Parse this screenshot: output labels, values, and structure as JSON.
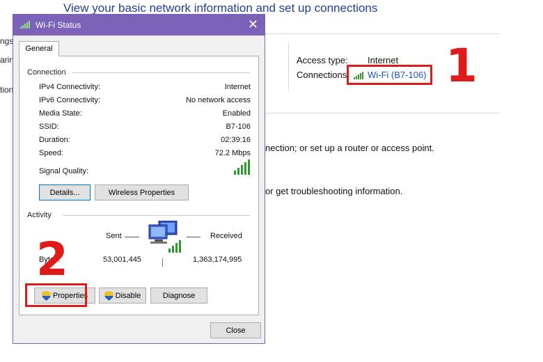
{
  "background": {
    "title": "View your basic network information and set up connections",
    "left_fragments": [
      "ngs",
      "arin",
      "tion"
    ],
    "access_type_label": "Access type:",
    "access_type_value": "Internet",
    "connections_label": "Connections:",
    "connection_link": "Wi-Fi (B7-106)",
    "setup_text": "nection; or set up a router or access point.",
    "troubleshoot_text": "or get troubleshooting information."
  },
  "annotations": {
    "step1": "1",
    "step2": "2",
    "red_color": "#e01a1a"
  },
  "dialog": {
    "title": "Wi-Fi Status",
    "tab_general": "General",
    "connection": {
      "heading": "Connection",
      "rows": [
        {
          "label": "IPv4 Connectivity:",
          "value": "Internet"
        },
        {
          "label": "IPv6 Connectivity:",
          "value": "No network access"
        },
        {
          "label": "Media State:",
          "value": "Enabled"
        },
        {
          "label": "SSID:",
          "value": "B7-106"
        },
        {
          "label": "Duration:",
          "value": "02:39:16"
        },
        {
          "label": "Speed:",
          "value": "72.2 Mbps"
        }
      ],
      "signal_quality_label": "Signal Quality:",
      "signal_bars": 5,
      "details_button": "Details...",
      "wireless_properties_button": "Wireless Properties"
    },
    "activity": {
      "heading": "Activity",
      "sent_label": "Sent",
      "received_label": "Received",
      "bytes_label": "Bytes:",
      "bytes_sent": "53,001,445",
      "bytes_received": "1,363,174,995"
    },
    "properties_button": "Properties",
    "disable_button": "Disable",
    "diagnose_button": "Diagnose",
    "close_button": "Close",
    "accent_color": "#7b62b8"
  }
}
